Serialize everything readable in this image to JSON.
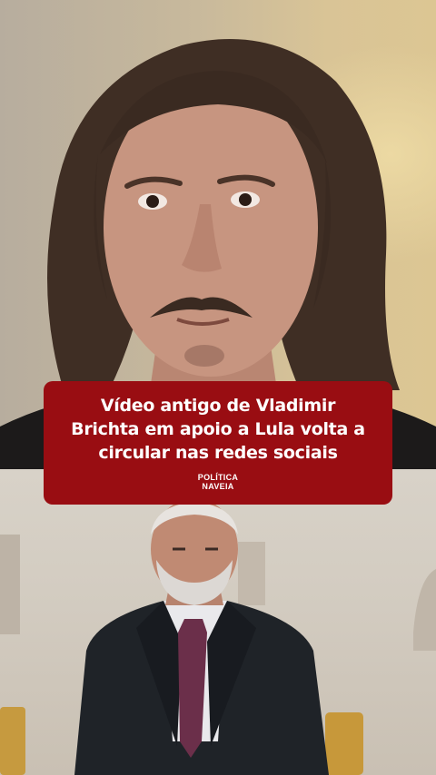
{
  "headline": {
    "lines": [
      "Vídeo antigo de Vladimir",
      "Brichta em apoio a Lula volta a",
      "circular nas redes sociais"
    ]
  },
  "brand": {
    "line1": "POLÍTICA",
    "line2": "NAVEIA"
  },
  "colors": {
    "card_background": "#990d12",
    "card_text": "#ffffff"
  },
  "images": {
    "top": "man-with-long-hair-and-mustache-photo",
    "bottom": "elderly-man-in-dark-suit-photo"
  }
}
